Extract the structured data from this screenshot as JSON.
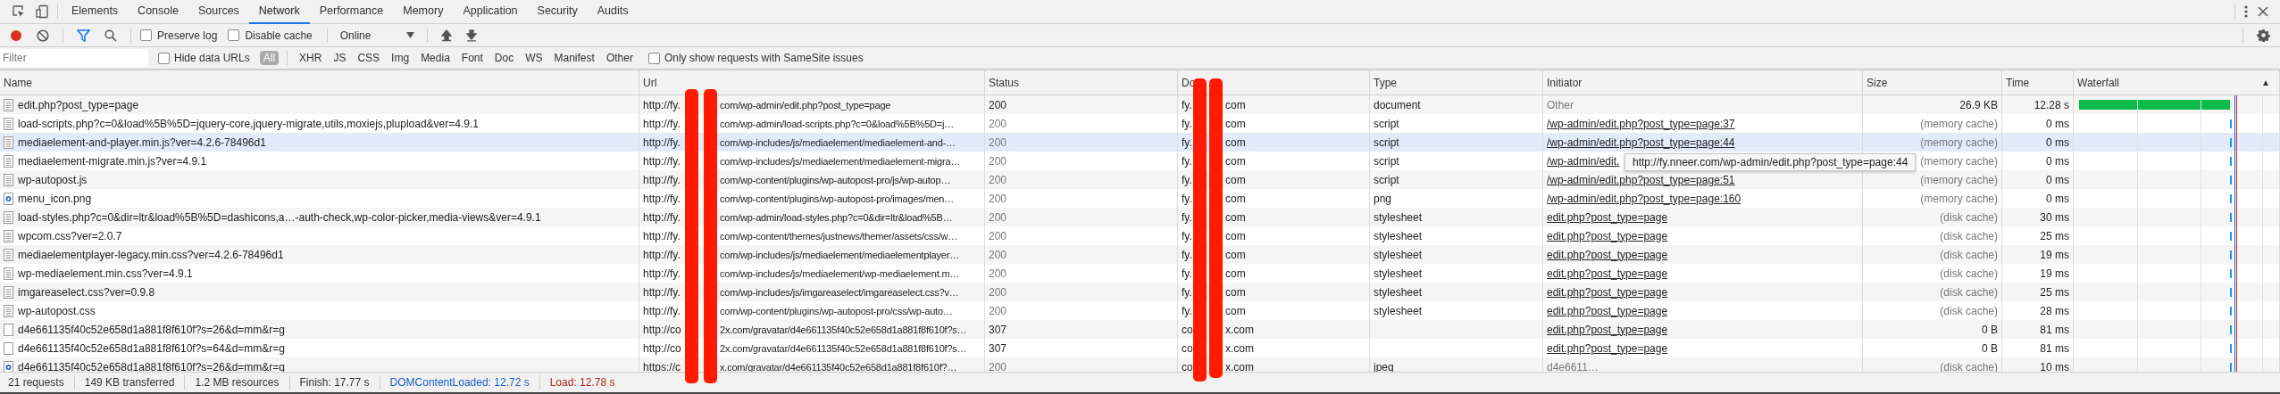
{
  "devtools_tabs": [
    {
      "label": "Elements",
      "selected": false
    },
    {
      "label": "Console",
      "selected": false
    },
    {
      "label": "Sources",
      "selected": false
    },
    {
      "label": "Network",
      "selected": true
    },
    {
      "label": "Performance",
      "selected": false
    },
    {
      "label": "Memory",
      "selected": false
    },
    {
      "label": "Application",
      "selected": false
    },
    {
      "label": "Security",
      "selected": false
    },
    {
      "label": "Audits",
      "selected": false
    }
  ],
  "toolbar": {
    "recording": true,
    "filter_active": true,
    "preserve_log": {
      "label": "Preserve log",
      "checked": false
    },
    "disable_cache": {
      "label": "Disable cache",
      "checked": false
    },
    "throttling": "Online"
  },
  "filter_bar": {
    "placeholder": "Filter",
    "hide_data_urls": {
      "label": "Hide data URLs",
      "checked": false
    },
    "types": [
      {
        "label": "All",
        "selected": true
      },
      {
        "label": "XHR",
        "selected": false
      },
      {
        "label": "JS",
        "selected": false
      },
      {
        "label": "CSS",
        "selected": false
      },
      {
        "label": "Img",
        "selected": false
      },
      {
        "label": "Media",
        "selected": false
      },
      {
        "label": "Font",
        "selected": false
      },
      {
        "label": "Doc",
        "selected": false
      },
      {
        "label": "WS",
        "selected": false
      },
      {
        "label": "Manifest",
        "selected": false
      },
      {
        "label": "Other",
        "selected": false
      }
    ],
    "samesite": {
      "label": "Only show requests with SameSite issues",
      "checked": false
    }
  },
  "columns": [
    {
      "label": "Name"
    },
    {
      "label": "Url"
    },
    {
      "label": "Status"
    },
    {
      "label": "Do"
    },
    {
      "label": "Type"
    },
    {
      "label": "Initiator"
    },
    {
      "label": "Size"
    },
    {
      "label": "Time"
    },
    {
      "label": "Waterfall",
      "sort_glyph": "▲"
    }
  ],
  "rows": [
    {
      "kind": "document",
      "name": "edit.php?post_type=page",
      "url_start": "http://fy.",
      "url_end": "com/wp-admin/edit.php?post_type=page",
      "status": "200",
      "cached": false,
      "domain_start": "fy.",
      "domain_end": "com",
      "type": "document",
      "initiator": "Other",
      "initiator_link": false,
      "size": "26.9 KB",
      "time": "12.28 s",
      "highlighted": false
    },
    {
      "kind": "document",
      "name": "load-scripts.php?c=0&load%5B%5D=jquery-core,jquery-migrate,utils,moxiejs,plupload&ver=4.9.1",
      "url_start": "http://fy.",
      "url_end": "com/wp-admin/load-scripts.php?c=0&load%5B%5D=j…",
      "status": "200",
      "cached": true,
      "domain_start": "fy.",
      "domain_end": "com",
      "type": "script",
      "initiator": "/wp-admin/edit.php?post_type=page:37",
      "initiator_link": true,
      "size": "(memory cache)",
      "time": "0 ms",
      "highlighted": false
    },
    {
      "kind": "document",
      "name": "mediaelement-and-player.min.js?ver=4.2.6-78496d1",
      "url_start": "http://fy.",
      "url_end": "com/wp-includes/js/mediaelement/mediaelement-and-…",
      "status": "200",
      "cached": true,
      "domain_start": "fy.",
      "domain_end": "com",
      "type": "script",
      "initiator": "/wp-admin/edit.php?post_type=page:44",
      "initiator_link": true,
      "size": "(memory cache)",
      "time": "0 ms",
      "highlighted": true
    },
    {
      "kind": "document",
      "name": "mediaelement-migrate.min.js?ver=4.9.1",
      "url_start": "http://fy.",
      "url_end": "com/wp-includes/js/mediaelement/mediaelement-migra…",
      "status": "200",
      "cached": true,
      "domain_start": "fy.",
      "domain_end": "com",
      "type": "script",
      "initiator": "/wp-admin/edit.",
      "initiator_link": true,
      "size": "(memory cache)",
      "time": "0 ms",
      "highlighted": false
    },
    {
      "kind": "document",
      "name": "wp-autopost.js",
      "url_start": "http://fy.",
      "url_end": "com/wp-content/plugins/wp-autopost-pro/js/wp-autop…",
      "status": "200",
      "cached": true,
      "domain_start": "fy.",
      "domain_end": "com",
      "type": "script",
      "initiator": "/wp-admin/edit.php?post_type=page:51",
      "initiator_link": true,
      "size": "(memory cache)",
      "time": "0 ms",
      "highlighted": false
    },
    {
      "kind": "image",
      "name": "menu_icon.png",
      "url_start": "http://fy.",
      "url_end": "com/wp-content/plugins/wp-autopost-pro/images/men…",
      "status": "200",
      "cached": true,
      "domain_start": "fy.",
      "domain_end": "com",
      "type": "png",
      "initiator": "/wp-admin/edit.php?post_type=page:160",
      "initiator_link": true,
      "size": "(memory cache)",
      "time": "0 ms",
      "highlighted": false
    },
    {
      "kind": "document",
      "name": "load-styles.php?c=0&dir=ltr&load%5B%5D=dashicons,a…-auth-check,wp-color-picker,media-views&ver=4.9.1",
      "url_start": "http://fy.",
      "url_end": "com/wp-admin/load-styles.php?c=0&dir=ltr&load%5B…",
      "status": "200",
      "cached": true,
      "domain_start": "fy.",
      "domain_end": "com",
      "type": "stylesheet",
      "initiator": "edit.php?post_type=page",
      "initiator_link": true,
      "size": "(disk cache)",
      "time": "30 ms",
      "highlighted": false
    },
    {
      "kind": "document",
      "name": "wpcom.css?ver=2.0.7",
      "url_start": "http://fy.",
      "url_end": "com/wp-content/themes/justnews/themer/assets/css/w…",
      "status": "200",
      "cached": true,
      "domain_start": "fy.",
      "domain_end": "com",
      "type": "stylesheet",
      "initiator": "edit.php?post_type=page",
      "initiator_link": true,
      "size": "(disk cache)",
      "time": "25 ms",
      "highlighted": false
    },
    {
      "kind": "document",
      "name": "mediaelementplayer-legacy.min.css?ver=4.2.6-78496d1",
      "url_start": "http://fy.",
      "url_end": "com/wp-includes/js/mediaelement/mediaelementplayer…",
      "status": "200",
      "cached": true,
      "domain_start": "fy.",
      "domain_end": "com",
      "type": "stylesheet",
      "initiator": "edit.php?post_type=page",
      "initiator_link": true,
      "size": "(disk cache)",
      "time": "19 ms",
      "highlighted": false
    },
    {
      "kind": "document",
      "name": "wp-mediaelement.min.css?ver=4.9.1",
      "url_start": "http://fy.",
      "url_end": "com/wp-includes/js/mediaelement/wp-mediaelement.m…",
      "status": "200",
      "cached": true,
      "domain_start": "fy.",
      "domain_end": "com",
      "type": "stylesheet",
      "initiator": "edit.php?post_type=page",
      "initiator_link": true,
      "size": "(disk cache)",
      "time": "19 ms",
      "highlighted": false
    },
    {
      "kind": "document",
      "name": "imgareaselect.css?ver=0.9.8",
      "url_start": "http://fy.",
      "url_end": "com/wp-includes/js/imgareaselect/imgareaselect.css?v…",
      "status": "200",
      "cached": true,
      "domain_start": "fy.",
      "domain_end": "com",
      "type": "stylesheet",
      "initiator": "edit.php?post_type=page",
      "initiator_link": true,
      "size": "(disk cache)",
      "time": "25 ms",
      "highlighted": false
    },
    {
      "kind": "document",
      "name": "wp-autopost.css",
      "url_start": "http://fy.",
      "url_end": "com/wp-content/plugins/wp-autopost-pro/css/wp-auto…",
      "status": "200",
      "cached": true,
      "domain_start": "fy.",
      "domain_end": "com",
      "type": "stylesheet",
      "initiator": "edit.php?post_type=page",
      "initiator_link": true,
      "size": "(disk cache)",
      "time": "28 ms",
      "highlighted": false
    },
    {
      "kind": "blank",
      "name": "d4e661135f40c52e658d1a881f8f610f?s=26&d=mm&r=g",
      "url_start": "http://co",
      "url_end": "2x.com/gravatar/d4e661135f40c52e658d1a881f8f610f?s…",
      "status": "307",
      "cached": false,
      "domain_start": "co",
      "domain_end": "x.com",
      "initiator": "edit.php?post_type=page",
      "initiator_link": true,
      "size": "0 B",
      "time": "81 ms",
      "highlighted": false
    },
    {
      "kind": "blank",
      "name": "d4e661135f40c52e658d1a881f8f610f?s=64&d=mm&r=g",
      "url_start": "http://co",
      "url_end": "2x.com/gravatar/d4e661135f40c52e658d1a881f8f610f?s…",
      "status": "307",
      "cached": false,
      "domain_start": "co",
      "domain_end": "x.com",
      "initiator": "edit.php?post_type=page",
      "initiator_link": true,
      "size": "0 B",
      "time": "81 ms",
      "highlighted": false
    },
    {
      "kind": "image",
      "name": "d4e661135f40c52e658d1a881f8f610f?s=26&d=mm&r=g",
      "url_start": "https://c",
      "url_end": "x.com/gravatar/d4e661135f40c52e658d1a881f8f610f?…",
      "status": "200",
      "cached": true,
      "domain_start": "co",
      "domain_end": "x.com",
      "type": "jpeg",
      "initiator": "d4e6611…",
      "initiator_link": false,
      "size": "(disk cache)",
      "time": "10 ms",
      "highlighted": false
    }
  ],
  "tooltip": "http://fy.nneer.com/wp-admin/edit.php?post_type=page:44",
  "status_bar": [
    {
      "text": "21 requests",
      "color": "#333333"
    },
    {
      "text": "149 KB transferred",
      "color": "#333333"
    },
    {
      "text": "1.2 MB resources",
      "color": "#333333"
    },
    {
      "text": "Finish: 17.77 s",
      "color": "#333333"
    },
    {
      "text": "DOMContentLoaded: 12.72 s",
      "color": "#1a5fc8"
    },
    {
      "text": "Load: 12.78 s",
      "color": "#b3261e"
    }
  ]
}
